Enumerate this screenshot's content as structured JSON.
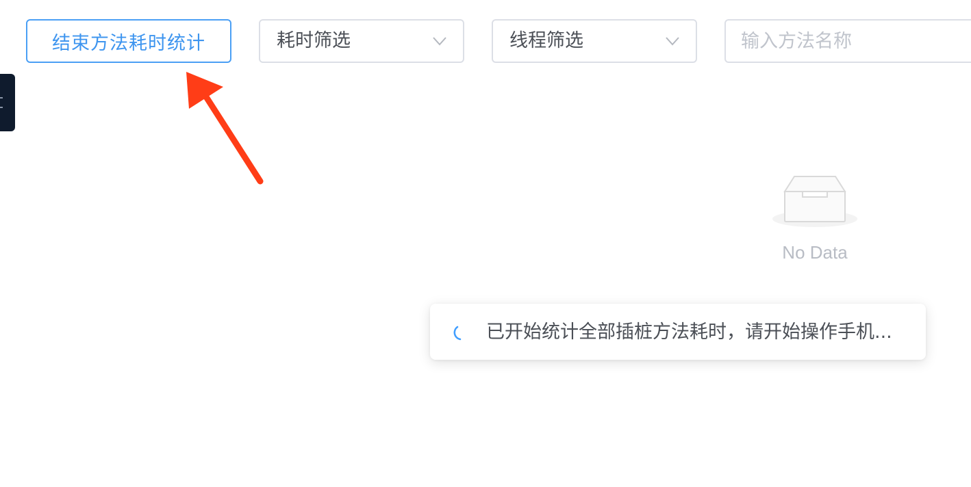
{
  "toolbar": {
    "stop_button_label": "结束方法耗时统计",
    "time_filter": {
      "selected": "耗时筛选",
      "icon": "chevron-down-icon"
    },
    "thread_filter": {
      "selected": "线程筛选",
      "icon": "chevron-down-icon"
    },
    "search": {
      "placeholder": "输入方法名称",
      "value": ""
    }
  },
  "empty_state": {
    "icon": "inbox-empty-icon",
    "text": "No Data"
  },
  "toast": {
    "icon": "loading-spinner-icon",
    "message": "已开始统计全部插桩方法耗时，请开始操作手机..."
  },
  "annotation": {
    "icon": "red-arrow-icon",
    "color": "#ff3d17"
  },
  "colors": {
    "primary": "#4a9ff5",
    "border": "#dcdfe6",
    "side_tab": "#0f1b2d"
  }
}
